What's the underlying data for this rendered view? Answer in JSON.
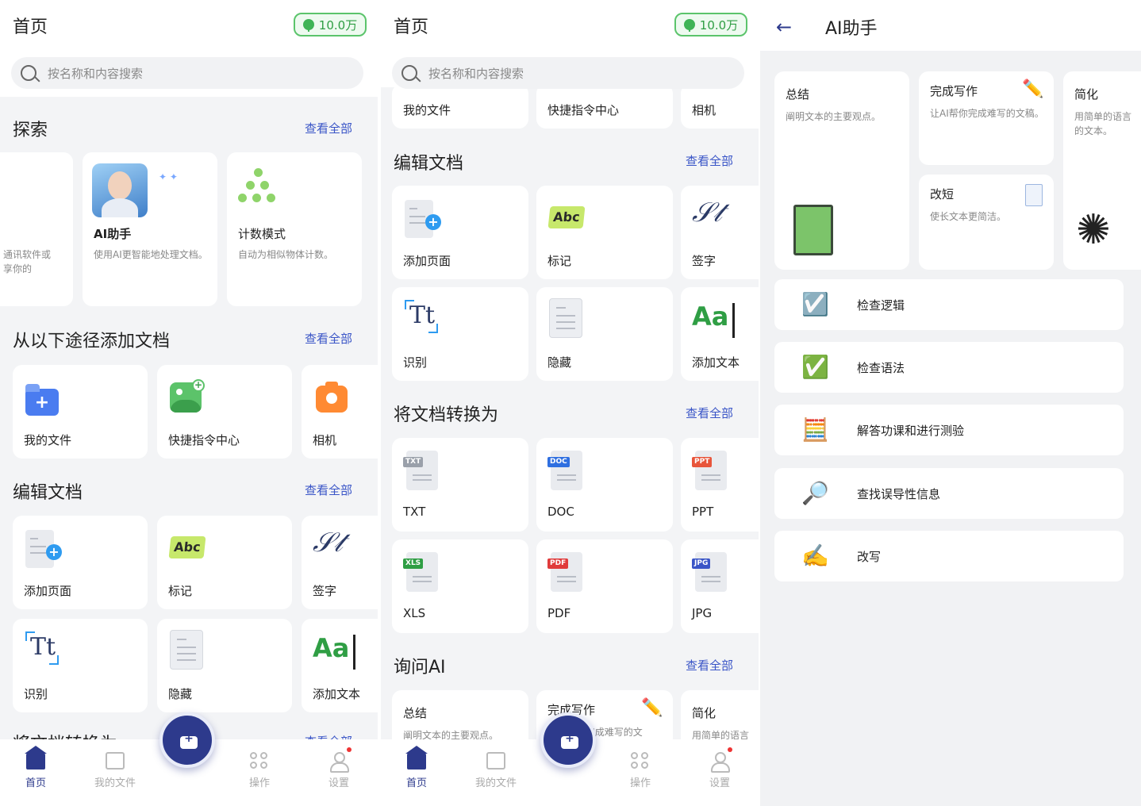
{
  "home": {
    "title": "首页",
    "coins": "10.0万",
    "search_placeholder": "按名称和内容搜索",
    "explore": {
      "title": "探索",
      "more": "查看全部",
      "partial_desc": "通讯软件或\n享你的",
      "cards": [
        {
          "title": "AI助手",
          "desc": "使用AI更智能地处理文档。"
        },
        {
          "title": "计数模式",
          "desc": "自动为相似物体计数。"
        }
      ]
    },
    "add": {
      "title": "从以下途径添加文档",
      "more": "查看全部",
      "items": [
        {
          "label": "我的文件",
          "icon": "folder-plus-icon"
        },
        {
          "label": "快捷指令中心",
          "icon": "image-plus-icon"
        },
        {
          "label": "相机",
          "icon": "camera-icon"
        }
      ]
    },
    "edit": {
      "title": "编辑文档",
      "more": "查看全部",
      "items": [
        {
          "label": "添加页面",
          "icon": "add-page-icon"
        },
        {
          "label": "标记",
          "icon": "highlight-icon"
        },
        {
          "label": "签字",
          "icon": "signature-icon"
        },
        {
          "label": "识别",
          "icon": "ocr-icon"
        },
        {
          "label": "隐藏",
          "icon": "redact-icon"
        },
        {
          "label": "添加文本",
          "icon": "add-text-icon"
        }
      ]
    },
    "convert": {
      "title": "将文档转换为",
      "more": "查看全部",
      "items": [
        {
          "label": "TXT",
          "tag": "TXT",
          "color": "#9aa0aa"
        },
        {
          "label": "DOC",
          "tag": "DOC",
          "color": "#2f6fe0"
        },
        {
          "label": "PPT",
          "tag": "PPT",
          "color": "#e8553b"
        },
        {
          "label": "XLS",
          "tag": "XLS",
          "color": "#2f9e44"
        },
        {
          "label": "PDF",
          "tag": "PDF",
          "color": "#e03b3b"
        },
        {
          "label": "JPG",
          "tag": "JPG",
          "color": "#3a55c7"
        }
      ]
    },
    "ask_ai": {
      "title": "询问AI",
      "more": "查看全部",
      "items": [
        {
          "title": "总结",
          "desc": "阐明文本的主要观点。"
        },
        {
          "title": "完成写作",
          "desc": "让AI帮你完成难写的文"
        },
        {
          "title": "简化",
          "desc": "用简单的语言"
        }
      ]
    },
    "nav": [
      {
        "label": "首页",
        "icon": "home-icon",
        "active": true
      },
      {
        "label": "我的文件",
        "icon": "folder-icon",
        "active": false
      },
      {
        "label": "操作",
        "icon": "grid-icon",
        "active": false
      },
      {
        "label": "设置",
        "icon": "user-icon",
        "active": false
      }
    ],
    "partial_add_row": [
      "我的文件",
      "快捷指令中心",
      "相机"
    ]
  },
  "ai": {
    "title": "AI助手",
    "cards": [
      {
        "title": "总结",
        "desc": "阐明文本的主要观点。"
      },
      {
        "title": "完成写作",
        "desc": "让AI帮你完成难写的文稿。"
      },
      {
        "title": "改短",
        "desc": "使长文本更简洁。"
      },
      {
        "title": "简化",
        "desc": "用简单的语言\n的文本。"
      }
    ],
    "list": [
      {
        "emoji": "☑️",
        "label": "检查逻辑"
      },
      {
        "emoji": "✅",
        "label": "检查语法"
      },
      {
        "emoji": "🧮",
        "label": "解答功课和进行测验"
      },
      {
        "emoji": "🔎",
        "label": "查找误导性信息"
      },
      {
        "emoji": "✍️",
        "label": "改写"
      }
    ]
  },
  "colors": {
    "accent": "#2d3a8c",
    "link": "#3a55c7",
    "coin_green": "#5bc46b"
  }
}
